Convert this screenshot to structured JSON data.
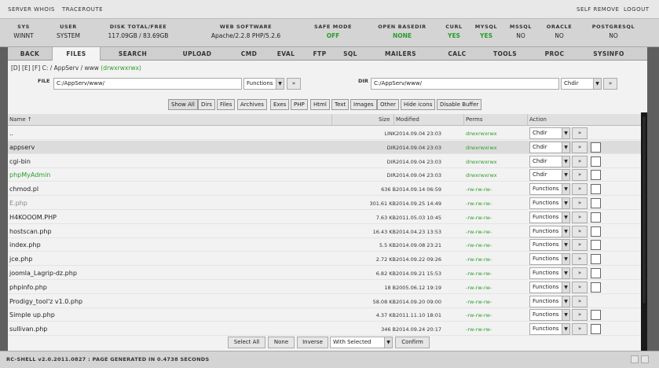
{
  "topbar": {
    "server_whois": "SERVER WHOIS",
    "traceroute": "TRACEROUTE",
    "self_remove": "SELF REMOVE",
    "logout": "LOGOUT"
  },
  "info": [
    {
      "label": "SYS",
      "value": "WINNT",
      "ok": false
    },
    {
      "label": "USER",
      "value": "SYSTEM",
      "ok": false
    },
    {
      "label": "DISK TOTAL/FREE",
      "value": "117.09GB / 83.69GB",
      "ok": false
    },
    {
      "label": "WEB SOFTWARE",
      "value": "Apache/2.2.8 PHP/5.2.6",
      "ok": false
    },
    {
      "label": "SAFE MODE",
      "value": "OFF",
      "ok": true
    },
    {
      "label": "OPEN BASEDIR",
      "value": "NONE",
      "ok": true
    },
    {
      "label": "CURL",
      "value": "YES",
      "ok": true
    },
    {
      "label": "MYSQL",
      "value": "YES",
      "ok": true
    },
    {
      "label": "MSSQL",
      "value": "NO",
      "ok": false
    },
    {
      "label": "ORACLE",
      "value": "NO",
      "ok": false
    },
    {
      "label": "POSTGRESQL",
      "value": "NO",
      "ok": false
    }
  ],
  "nav": [
    "BACK",
    "FILES",
    "SEARCH",
    "UPLOAD",
    "CMD",
    "EVAL",
    "FTP",
    "SQL",
    "MAILERS",
    "CALC",
    "TOOLS",
    "PROC",
    "SYSINFO"
  ],
  "path": {
    "drives": [
      "[D]",
      "[E]",
      "[F]"
    ],
    "location": "C: / AppServ / www",
    "perms": "(drwxrwxrwx)"
  },
  "form": {
    "file_label": "FILE",
    "file_value": "C:/AppServ/www/",
    "file_select": "Functions",
    "go": "»",
    "dir_label": "DIR",
    "dir_value": "C:/AppServ/www/",
    "dir_select": "Chdir"
  },
  "filters": [
    "Show All",
    "Dirs",
    "Files",
    "Archives",
    "Exes",
    "PHP",
    "Html",
    "Text",
    "Images",
    "Other",
    "Hide icons",
    "Disable Buffer"
  ],
  "columns": {
    "name": "Name ↑",
    "size": "Size",
    "modified": "Modified",
    "perms": "Perms",
    "action": "Action"
  },
  "rows": [
    {
      "name": "..",
      "size": "LINK",
      "modified": "2014.09.04 23:03",
      "perms": "drwxrwxrwx",
      "action": "Chdir",
      "style": "",
      "cb": false
    },
    {
      "name": "appserv",
      "size": "DIR",
      "modified": "2014.09.04 23:03",
      "perms": "drwxrwxrwx",
      "action": "Chdir",
      "style": "",
      "cb": true
    },
    {
      "name": "cgi-bin",
      "size": "DIR",
      "modified": "2014.09.04 23:03",
      "perms": "drwxrwxrwx",
      "action": "Chdir",
      "style": "",
      "cb": true
    },
    {
      "name": "phpMyAdmin",
      "size": "DIR",
      "modified": "2014.09.04 23:03",
      "perms": "drwxrwxrwx",
      "action": "Chdir",
      "style": "green",
      "cb": true
    },
    {
      "name": "chmod.pl",
      "size": "636 B",
      "modified": "2014.09.14 06:59",
      "perms": "-rw-rw-rw-",
      "action": "Functions",
      "style": "",
      "cb": true
    },
    {
      "name": "E.php",
      "size": "301.61 KB",
      "modified": "2014.09.25 14:49",
      "perms": "-rw-rw-rw-",
      "action": "Functions",
      "style": "grey",
      "cb": true
    },
    {
      "name": "H4KOOOM.PHP",
      "size": "7.63 KB",
      "modified": "2011.05.03 10:45",
      "perms": "-rw-rw-rw-",
      "action": "Functions",
      "style": "",
      "cb": true
    },
    {
      "name": "hostscan.php",
      "size": "16.43 KB",
      "modified": "2014.04.23 13:53",
      "perms": "-rw-rw-rw-",
      "action": "Functions",
      "style": "",
      "cb": true
    },
    {
      "name": "index.php",
      "size": "5.5 KB",
      "modified": "2014.09.08 23:21",
      "perms": "-rw-rw-rw-",
      "action": "Functions",
      "style": "",
      "cb": true
    },
    {
      "name": "jce.php",
      "size": "2.72 KB",
      "modified": "2014.09.22 09:26",
      "perms": "-rw-rw-rw-",
      "action": "Functions",
      "style": "",
      "cb": true
    },
    {
      "name": "joomla_Lagrip-dz.php",
      "size": "6.82 KB",
      "modified": "2014.09.21 15:53",
      "perms": "-rw-rw-rw-",
      "action": "Functions",
      "style": "",
      "cb": true
    },
    {
      "name": "phpinfo.php",
      "size": "18 B",
      "modified": "2005.06.12 19:19",
      "perms": "-rw-rw-rw-",
      "action": "Functions",
      "style": "",
      "cb": true
    },
    {
      "name": "Prodigy_tool'z v1.0.php",
      "size": "58.08 KB",
      "modified": "2014.09.20 09:00",
      "perms": "-rw-rw-rw-",
      "action": "Functions",
      "style": "",
      "cb": false
    },
    {
      "name": "Simple up.php",
      "size": "4.37 KB",
      "modified": "2011.11.10 18:01",
      "perms": "-rw-rw-rw-",
      "action": "Functions",
      "style": "",
      "cb": true
    },
    {
      "name": "sullivan.php",
      "size": "346 B",
      "modified": "2014.09.24 20:17",
      "perms": "-rw-rw-rw-",
      "action": "Functions",
      "style": "",
      "cb": true
    }
  ],
  "bottom": {
    "select_all": "Select All",
    "none": "None",
    "inverse": "Inverse",
    "with_selected": "With Selected",
    "confirm": "Confirm"
  },
  "footer": {
    "text": "RC-SHELL v2.0.2011.0827 : PAGE GENERATED IN 0.4738 SECONDS"
  }
}
